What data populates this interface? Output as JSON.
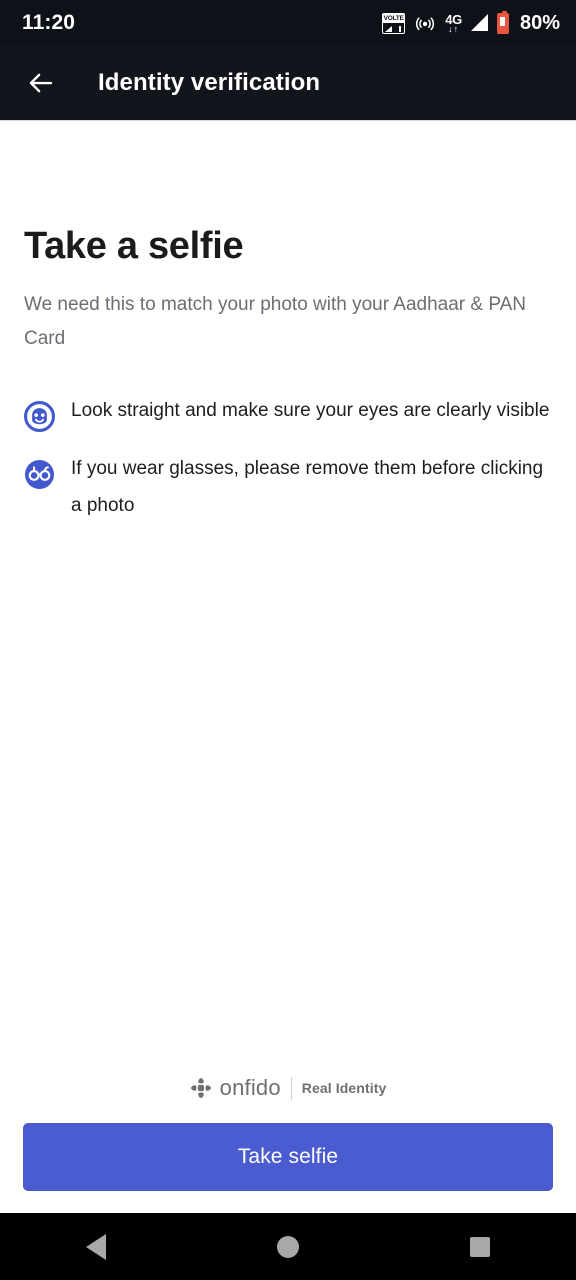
{
  "status_bar": {
    "time": "11:20",
    "battery_percent": "80%",
    "network_label": "4G",
    "network_arrows": "↓↑",
    "volte_label": "VOLTE",
    "icons": [
      "volte-icon",
      "hotspot-icon",
      "4g-icon",
      "signal-icon",
      "battery-icon"
    ]
  },
  "app_bar": {
    "back_icon": "arrow-left-icon",
    "title": "Identity verification"
  },
  "main": {
    "title": "Take a selfie",
    "subtitle": "We need this to match your photo with your Aadhaar & PAN Card",
    "tips": [
      {
        "icon": "face-outline-icon",
        "text": "Look straight and make sure your eyes are clearly visible"
      },
      {
        "icon": "glasses-icon",
        "text": "If you wear glasses, please remove them before clicking a photo"
      }
    ]
  },
  "footer": {
    "brand_logo": "onfido-logo-icon",
    "brand_name": "onfido",
    "tagline": "Real Identity",
    "cta_label": "Take selfie"
  },
  "nav_bar": {
    "back_label": "Back",
    "home_label": "Home",
    "recents_label": "Recents"
  },
  "colors": {
    "accent": "#4a5cd0",
    "app_bar_bg": "#13151d",
    "status_bar_bg": "#0f1118",
    "battery": "#e8563f",
    "nav_icon": "#a8a8a8",
    "subtitle_text": "#6d6d75",
    "body_text": "#1e1e22"
  }
}
